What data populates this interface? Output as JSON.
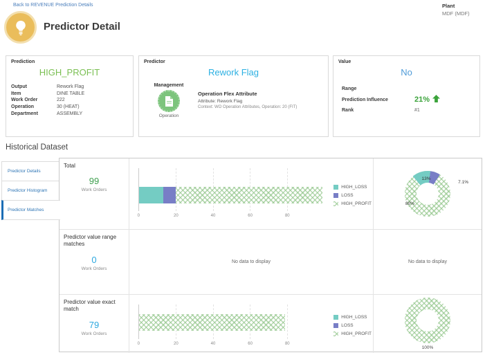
{
  "header": {
    "back_link": "Back to REVENUE Prediction Details",
    "title": "Predictor Detail",
    "plant_label": "Plant",
    "plant_value": "MDF (MDF)"
  },
  "cards": {
    "prediction": {
      "title": "Prediction",
      "value": "HIGH_PROFIT",
      "fields": [
        {
          "label": "Output",
          "value": "Rework Flag"
        },
        {
          "label": "Item",
          "value": "DINE TABLE"
        },
        {
          "label": "Work Order",
          "value": "222"
        },
        {
          "label": "Operation",
          "value": "30 (HEAT)"
        },
        {
          "label": "Department",
          "value": "ASSEMBLY"
        }
      ]
    },
    "predictor": {
      "title": "Predictor",
      "value": "Rework Flag",
      "management_label": "Management",
      "operation_label": "Operation",
      "attribute_title": "Operation Flex Attribute",
      "attribute_line": "Attribute: Rework Flag",
      "context_line": "Context: WO Operation Attributes, Operation: 20 (FIT)"
    },
    "value": {
      "title": "Value",
      "value": "No",
      "range_label": "Range",
      "range_value": "",
      "influence_label": "Prediction Influence",
      "influence_value": "21%",
      "rank_label": "Rank",
      "rank_value": "#1"
    }
  },
  "historical": {
    "title": "Historical Dataset",
    "tabs": [
      {
        "label": "Predictor Details",
        "active": false
      },
      {
        "label": "Predictor Histogram",
        "active": false
      },
      {
        "label": "Predictor Matches",
        "active": true
      }
    ],
    "legend": [
      "HIGH_LOSS",
      "LOSS",
      "HIGH_PROFIT"
    ],
    "rows": [
      {
        "header": "Total",
        "count": "99",
        "unit": "Work Orders",
        "bar": {
          "type": "stacked-horizontal-bar",
          "max": 100,
          "ticks": [
            "0",
            "20",
            "40",
            "60",
            "80"
          ],
          "series": [
            {
              "name": "HIGH_LOSS",
              "value": 13
            },
            {
              "name": "LOSS",
              "value": 7
            },
            {
              "name": "HIGH_PROFIT",
              "value": 79
            }
          ]
        },
        "donut": {
          "slices": [
            {
              "name": "HIGH_LOSS",
              "pct": 13.1,
              "label": "13%"
            },
            {
              "name": "LOSS",
              "pct": 7.1,
              "label": "7.1%"
            },
            {
              "name": "HIGH_PROFIT",
              "pct": 79.8,
              "label": "80%"
            }
          ]
        }
      },
      {
        "header": "Predictor value range matches",
        "count": "0",
        "unit": "Work Orders",
        "bar_no_data": "No data to display",
        "donut_no_data": "No data to display"
      },
      {
        "header": "Predictor value exact match",
        "count": "79",
        "unit": "Work Orders",
        "bar": {
          "type": "stacked-horizontal-bar",
          "max": 100,
          "ticks": [
            "0",
            "20",
            "40",
            "60",
            "80"
          ],
          "series": [
            {
              "name": "HIGH_LOSS",
              "value": 0
            },
            {
              "name": "LOSS",
              "value": 0
            },
            {
              "name": "HIGH_PROFIT",
              "value": 79
            }
          ]
        },
        "donut": {
          "slices": [
            {
              "name": "HIGH_PROFIT",
              "pct": 100,
              "label": "100%"
            }
          ]
        }
      }
    ]
  },
  "colors": {
    "high_loss": "#74ccc3",
    "loss": "#787ec6",
    "high_profit_hatch": "#8fc487",
    "count_green": "#3d9e4d",
    "count_blue": "#2ba7df"
  }
}
